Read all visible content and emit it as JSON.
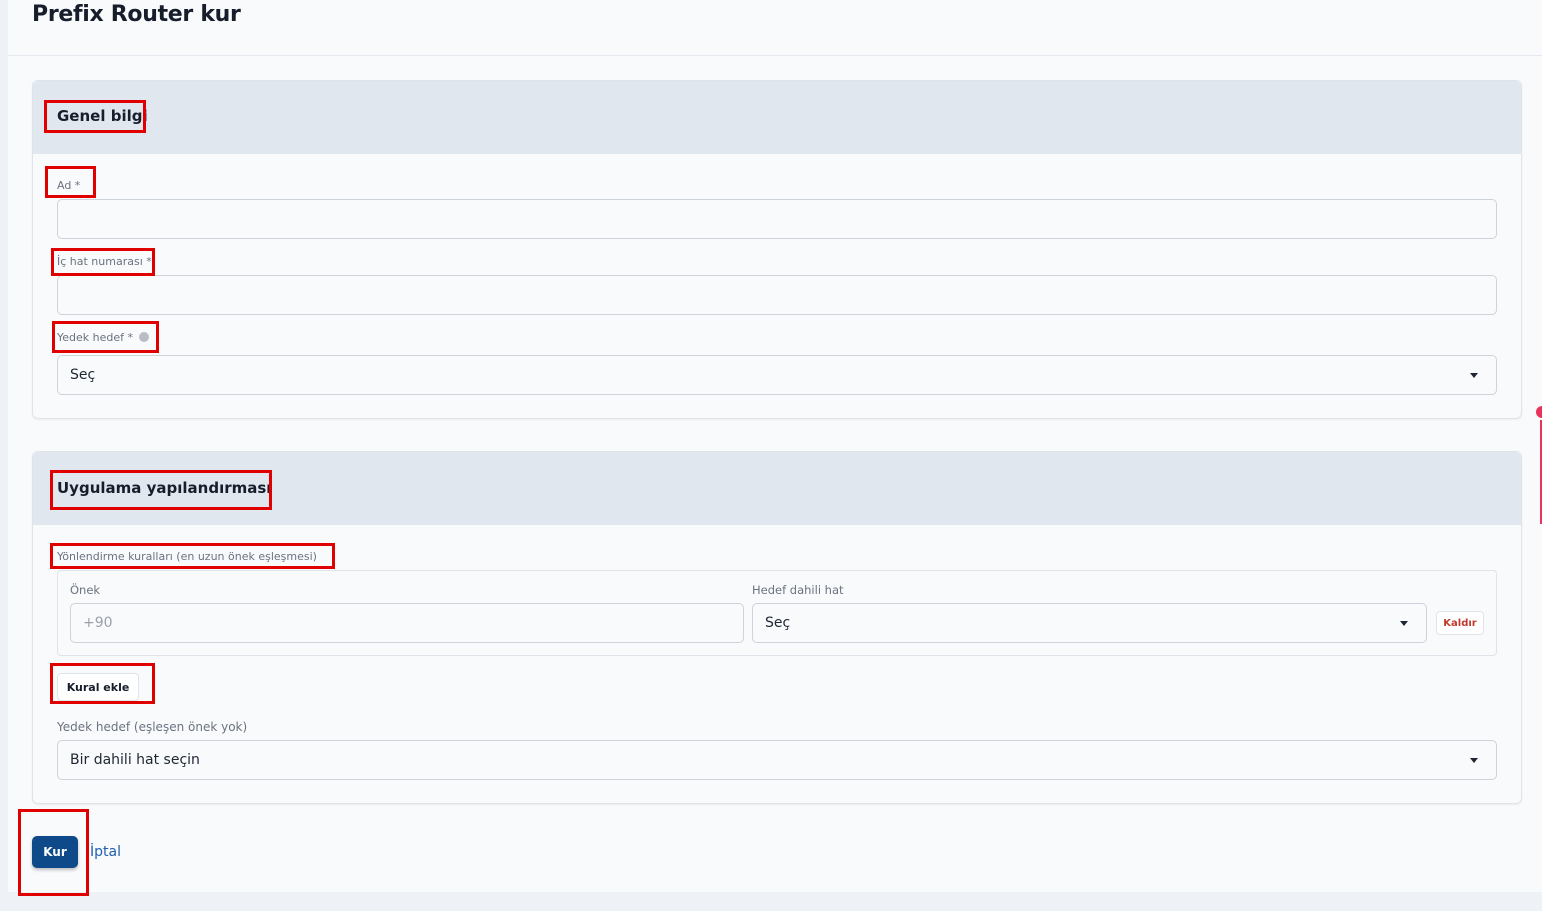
{
  "page": {
    "title": "Prefix Router kur"
  },
  "general": {
    "title": "Genel bilgi",
    "name_label": "Ad *",
    "name_value": "",
    "extension_label": "İç hat numarası *",
    "extension_value": "",
    "fallback_label": "Yedek hedef *",
    "fallback_value": "Seç"
  },
  "app_config": {
    "title": "Uygulama yapılandırması",
    "rules_label": "Yönlendirme kuralları (en uzun önek eşleşmesi)",
    "rules": [
      {
        "prefix_label": "Önek",
        "prefix_placeholder": "+90",
        "target_label": "Hedef dahili hat",
        "target_value": "Seç",
        "remove_label": "Kaldır"
      }
    ],
    "add_rule_label": "Kural ekle",
    "default_label": "Yedek hedef (eşleşen önek yok)",
    "default_value": "Bir dahili hat seçin"
  },
  "actions": {
    "submit_label": "Kur",
    "cancel_label": "İptal"
  },
  "colors": {
    "primary": "#0e4a8a",
    "highlight": "#e00000",
    "card_header": "#e1e7ef",
    "link": "#1f5fae",
    "danger": "#c0392b"
  },
  "icons": [
    "chevron-down-icon",
    "info-icon"
  ]
}
